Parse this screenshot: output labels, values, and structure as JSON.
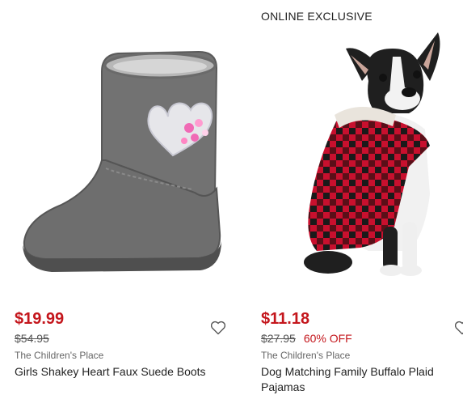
{
  "products": [
    {
      "price": "$19.99",
      "old_price": "$54.95",
      "discount": "",
      "brand": "The Children's Place",
      "title": "Girls Shakey Heart Faux Suede Boots",
      "image_alt": "gray faux suede boot with pink heart"
    },
    {
      "badge": "ONLINE EXCLUSIVE",
      "price": "$11.18",
      "old_price": "$27.95",
      "discount": "60% OFF",
      "brand": "The Children's Place",
      "title": "Dog Matching Family Buffalo Plaid Pajamas",
      "image_alt": "french bulldog wearing red buffalo plaid pajamas"
    }
  ],
  "colors": {
    "sale_red": "#c4161c",
    "boot_gray": "#6d6d6d",
    "plaid_red": "#c8102e"
  }
}
